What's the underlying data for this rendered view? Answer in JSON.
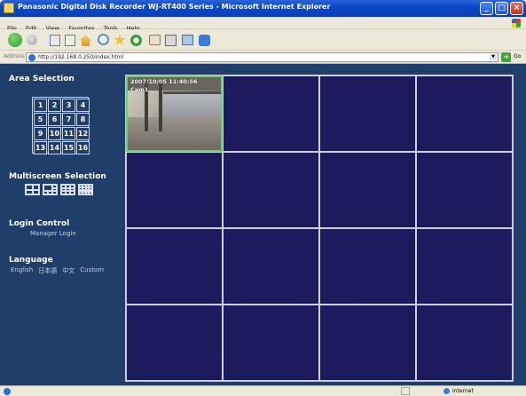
{
  "window": {
    "title": "Panasonic Digital Disk Recorder WJ-RT400 Series - Microsoft Internet Explorer"
  },
  "menu": [
    "File",
    "Edit",
    "View",
    "Favorites",
    "Tools",
    "Help"
  ],
  "address": {
    "label": "Address",
    "url": "http://192.168.0.250/index.html",
    "go_label": "Go"
  },
  "sidebar": {
    "area_title": "Area Selection",
    "areas": [
      "1",
      "2",
      "3",
      "4",
      "5",
      "6",
      "7",
      "8",
      "9",
      "10",
      "11",
      "12",
      "13",
      "14",
      "15",
      "16"
    ],
    "multiscreen_title": "Multiscreen Selection",
    "login_title": "Login Control",
    "login_link": "Manager Login",
    "language_title": "Language",
    "languages": [
      "English",
      "日本語",
      "中文",
      "Custom"
    ]
  },
  "camera": {
    "timestamp": "2007/10/05 11:40:56",
    "name": "Cam1"
  },
  "statusbar": {
    "zone": "Internet"
  }
}
